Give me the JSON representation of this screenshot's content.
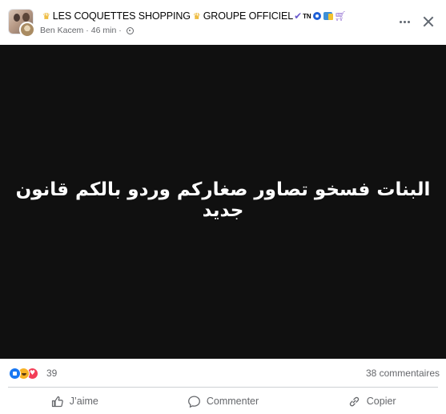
{
  "post": {
    "group_name": "LES COQUETTES SHOPPING",
    "group_suffix": "GROUPE OFFICIEL",
    "title_badges": {
      "tn": "TN"
    },
    "author": "Ben Kacem",
    "time": "46 min",
    "separator": "·"
  },
  "media": {
    "background": "#101010",
    "text": "البنات فسخو تصاور صغاركم وردو بالكم قانون جديد"
  },
  "stats": {
    "reaction_count": "39",
    "comments": "38 commentaires",
    "reaction_types": [
      "like",
      "haha",
      "love"
    ]
  },
  "actions": {
    "like": "J’aime",
    "comment": "Commenter",
    "share": "Copier"
  },
  "icons": {
    "more": "more-horizontal-icon",
    "close": "close-icon",
    "privacy": "globe-icon",
    "like": "thumbs-up-icon",
    "comment": "comment-bubble-icon",
    "share": "link-icon"
  },
  "colors": {
    "like_blue": "#1877f2",
    "haha_yellow": "#f7b125",
    "love_red": "#f33e58",
    "secondary_text": "#65676b"
  }
}
